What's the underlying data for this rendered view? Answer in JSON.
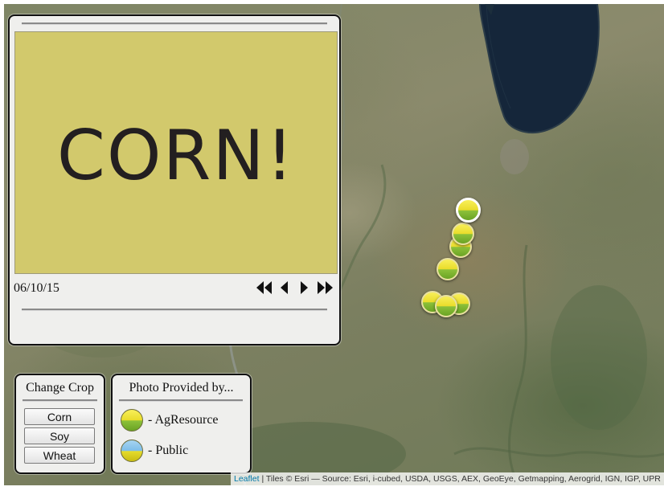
{
  "photo": {
    "image_text": "CORN!",
    "date": "06/10/15",
    "controls": [
      "first-icon",
      "prev-icon",
      "next-icon",
      "last-icon"
    ]
  },
  "crop_panel": {
    "title": "Change Crop",
    "buttons": [
      "Corn",
      "Soy",
      "Wheat"
    ]
  },
  "provider_panel": {
    "title": "Photo Provided by...",
    "items": [
      {
        "label": "- AgResource",
        "icon": "agresource-marker-icon"
      },
      {
        "label": "- Public",
        "icon": "public-marker-icon"
      }
    ]
  },
  "attribution": {
    "link": "Leaflet",
    "text": " | Tiles © Esri — Source: Esri, i-cubed, USDA, USGS, AEX, GeoEye, Getmapping, Aerogrid, IGN, IGP, UPR"
  },
  "markers": {
    "count": 7,
    "selected_index": 0,
    "provider": "AgResource"
  },
  "colors": {
    "photo_background": "#d2c96c",
    "lake": "#15263a",
    "agresource_marker": "#e9dc2a",
    "public_marker": "#7dbde8"
  }
}
